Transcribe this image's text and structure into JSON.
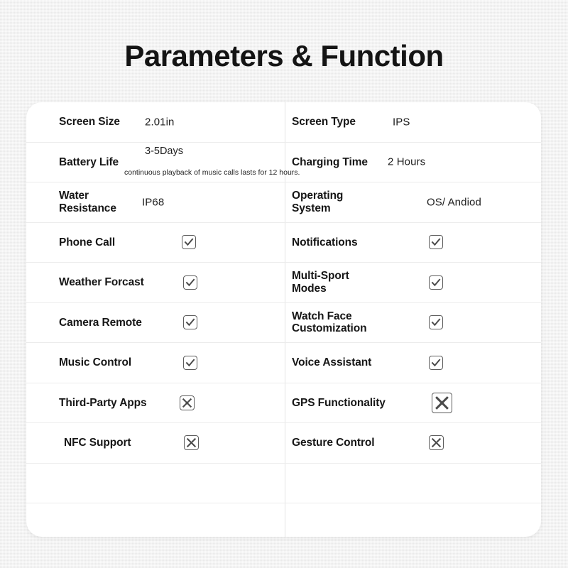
{
  "page": {
    "title": "Parameters & Function",
    "background_color": "#f1f1f1",
    "card_background": "#ffffff",
    "text_color": "#161616",
    "divider_color": "#ececec",
    "box_stroke_color": "#5c5c5c"
  },
  "table": {
    "rows": [
      {
        "left": {
          "label": "Screen Size",
          "value": "2.01in",
          "mark": "none"
        },
        "right": {
          "label": "Screen Type",
          "value": "IPS",
          "mark": "none"
        }
      },
      {
        "left": {
          "label": "Battery Life",
          "value": "3-5Days",
          "value_sub": "continuous playback of music calls lasts for 12 hours.",
          "mark": "none"
        },
        "right": {
          "label": "Charging Time",
          "value": "2 Hours",
          "mark": "none"
        }
      },
      {
        "left": {
          "label": "Water\nResistance",
          "value": "IP68",
          "mark": "none"
        },
        "right": {
          "label": "Operating\nSystem",
          "value": "OS/ Andiod",
          "mark": "none"
        }
      },
      {
        "left": {
          "label": "Phone Call",
          "value": "",
          "mark": "check"
        },
        "right": {
          "label": "Notifications",
          "value": "",
          "mark": "check"
        }
      },
      {
        "left": {
          "label": "Weather Forcast",
          "value": "",
          "mark": "check"
        },
        "right": {
          "label": "Multi-Sport\nModes",
          "value": "",
          "mark": "check"
        }
      },
      {
        "left": {
          "label": "Camera Remote",
          "value": "",
          "mark": "check"
        },
        "right": {
          "label": "Watch Face\nCustomization",
          "value": "",
          "mark": "check"
        }
      },
      {
        "left": {
          "label": "Music Control",
          "value": "",
          "mark": "check"
        },
        "right": {
          "label": "Voice Assistant",
          "value": "",
          "mark": "check"
        }
      },
      {
        "left": {
          "label": "Third-Party Apps",
          "value": "",
          "mark": "cross"
        },
        "right": {
          "label": "GPS Functionality",
          "value": "",
          "mark": "cross"
        }
      },
      {
        "left": {
          "label": "NFC Support",
          "value": "",
          "mark": "cross"
        },
        "right": {
          "label": "Gesture Control",
          "value": "",
          "mark": "cross"
        }
      },
      {
        "left": {
          "label": "",
          "value": "",
          "mark": "none"
        },
        "right": {
          "label": "",
          "value": "",
          "mark": "none"
        }
      },
      {
        "left": {
          "label": "",
          "value": "",
          "mark": "none"
        },
        "right": {
          "label": "",
          "value": "",
          "mark": "none"
        }
      }
    ]
  }
}
